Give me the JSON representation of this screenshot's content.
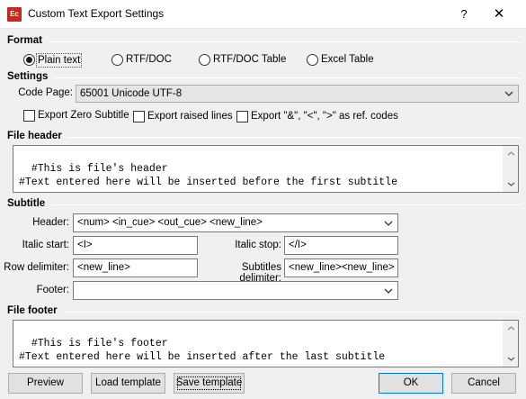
{
  "window": {
    "title": "Custom Text Export Settings",
    "app_icon_text": "Ec",
    "help_glyph": "?",
    "close_glyph": "✕"
  },
  "format": {
    "title": "Format",
    "options": [
      "Plain text",
      "RTF/DOC",
      "RTF/DOC Table",
      "Excel Table"
    ],
    "selected": "Plain text"
  },
  "settings": {
    "title": "Settings",
    "code_page_label": "Code Page:",
    "code_page_value": "65001 Unicode UTF-8",
    "export_zero_subtitle": "Export Zero Subtitle",
    "export_raised_lines": "Export raised lines",
    "export_ref_codes": "Export \"&\", \"<\", \">\" as ref. codes"
  },
  "file_header": {
    "title": "File header",
    "text": "#This is file's header\n#Text entered here will be inserted before the first subtitle"
  },
  "subtitle": {
    "title": "Subtitle",
    "header_label": "Header:",
    "header_value": "<num> <in_cue> <out_cue> <new_line>",
    "italic_start_label": "Italic start:",
    "italic_start_value": "<I>",
    "italic_stop_label": "Italic stop:",
    "italic_stop_value": "</I>",
    "row_delimiter_label": "Row delimiter:",
    "row_delimiter_value": "<new_line>",
    "subtitles_delimiter_label": "Subtitles delimiter:",
    "subtitles_delimiter_value": "<new_line><new_line>",
    "footer_label": "Footer:",
    "footer_value": ""
  },
  "file_footer": {
    "title": "File footer",
    "text": "#This is file's footer\n#Text entered here will be inserted after the last subtitle"
  },
  "buttons": {
    "preview": "Preview",
    "load_template": "Load template",
    "save_template": "Save template",
    "ok": "OK",
    "cancel": "Cancel"
  }
}
